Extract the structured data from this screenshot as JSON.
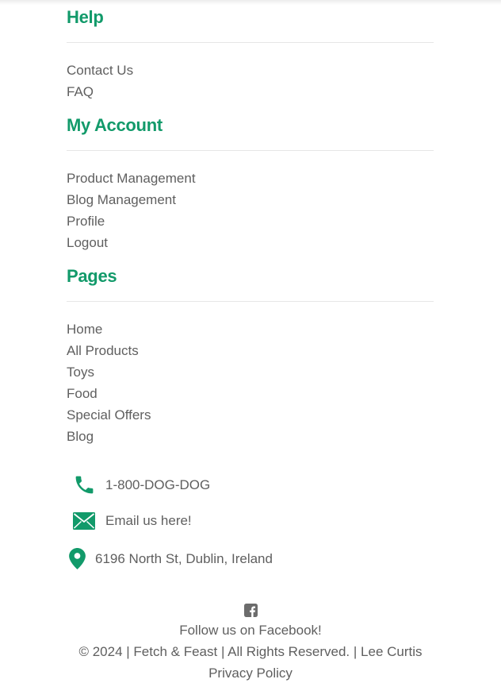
{
  "help": {
    "title": "Help",
    "links": [
      "Contact Us",
      "FAQ"
    ]
  },
  "account": {
    "title": "My Account",
    "links": [
      "Product Management",
      "Blog Management",
      "Profile",
      "Logout"
    ]
  },
  "pages": {
    "title": "Pages",
    "links": [
      "Home",
      "All Products",
      "Toys",
      "Food",
      "Special Offers",
      "Blog"
    ]
  },
  "contact": {
    "phone": "1-800-DOG-DOG",
    "email": "Email us here!",
    "address": "6196 North St, Dublin, Ireland",
    "icons": [
      "phone-icon",
      "envelope-icon",
      "map-pin-icon"
    ]
  },
  "footer": {
    "facebook_icon": "facebook-square-icon",
    "follow": "Follow us on Facebook!",
    "copyright_prefix": "© 2024 | Fetch & Feast | All Rights Reserved. |",
    "author": "Lee Curtis",
    "privacy": "Privacy Policy"
  },
  "colors": {
    "accent": "#129a6a",
    "text": "#5f5f5f",
    "divider": "#e6e6e6"
  }
}
